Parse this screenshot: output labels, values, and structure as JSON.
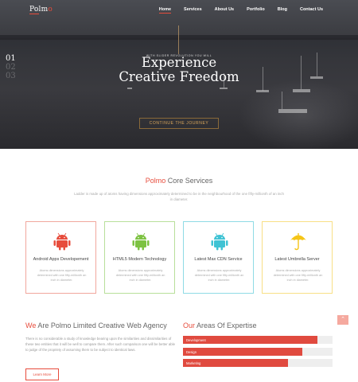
{
  "header": {
    "logo": "Polm",
    "logo_accent": "o",
    "nav": [
      "Home",
      "Services",
      "About Us",
      "Portfolio",
      "Blog",
      "Contact Us"
    ]
  },
  "hero": {
    "pretitle": "WITH SLIDER REVOLUTION YOU WILL",
    "title_line1": "Experience",
    "title_line2": "Creative Freedom",
    "cta": "CONTINUE THE JOURNEY",
    "slides": [
      "01",
      "02",
      "03"
    ],
    "current_slide": "01"
  },
  "services": {
    "title_accent": "Polmo",
    "title": "Core Services",
    "description": "Ladder is made up of atoms having dimensions approximately determined to be in the neighbourhood of the one fifty-millionth of an inch in diameter.",
    "cards": [
      {
        "title": "Android Apps Developement",
        "text": "Atoms dimensions approximately determined with one fifty-millionth an inch in diameter.",
        "icon": "android-icon",
        "color": "#e74c3c"
      },
      {
        "title": "HTML5 Modern Technology",
        "text": "Atoms dimensions approximately determined with one fifty-millionth an inch in diameter.",
        "icon": "android-icon",
        "color": "#7dc242"
      },
      {
        "title": "Latest Max CDN Service",
        "text": "Atoms dimensions approximately determined with one fifty-millionth an inch in diameter.",
        "icon": "android-icon",
        "color": "#3fc3d4"
      },
      {
        "title": "Latest Umbrella Server",
        "text": "Atoms dimensions approximately determined with one fifty-millionth an inch in diameter.",
        "icon": "umbrella-icon",
        "color": "#f5c518"
      }
    ]
  },
  "about": {
    "title_accent": "We",
    "title": "Are Polmo Limited Creative Web Agency",
    "text": "There is no considerable a study of knowledge bearing upon the similarities and dissimilarities of these two entities that it will be well to compare them. After such comparison one will be better able to judge of the propriety of assuming them to be subject to identical laws.",
    "more": "Learn More"
  },
  "expertise": {
    "title_accent": "Our",
    "title": "Areas Of Expertise",
    "skills": [
      {
        "label": "Development",
        "level": 0.9
      },
      {
        "label": "Design",
        "level": 0.8
      },
      {
        "label": "Marketing",
        "level": 0.7
      }
    ]
  },
  "colors": {
    "accent": "#e74c3c",
    "cta": "#d9a65a"
  },
  "back_to_top_icon": "chevron-up-icon"
}
